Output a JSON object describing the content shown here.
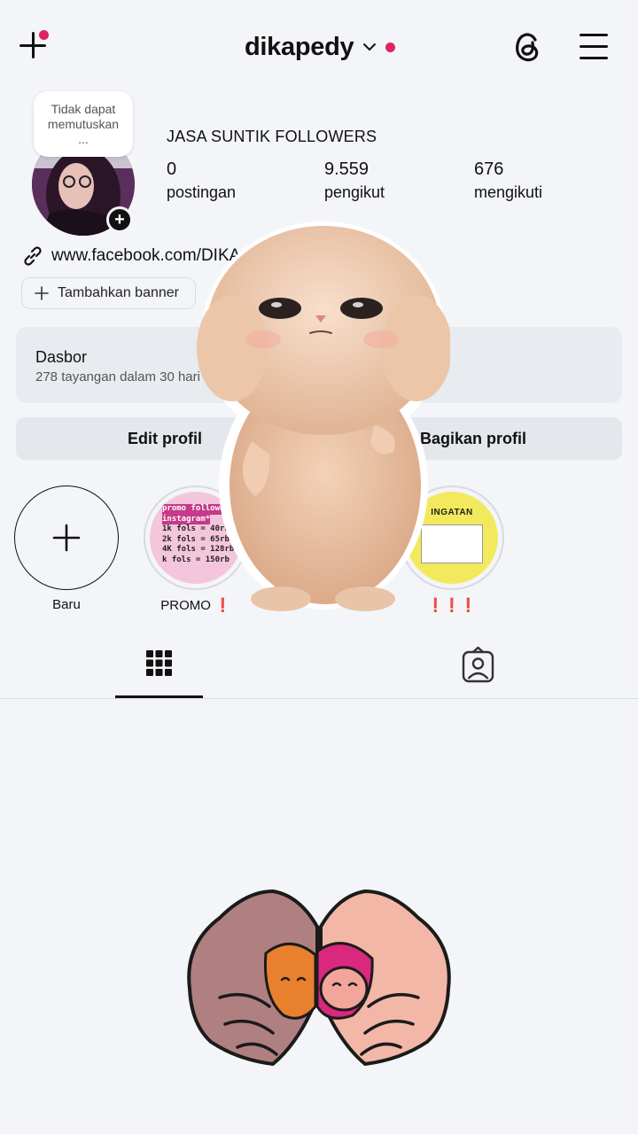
{
  "header": {
    "username": "dikapedy",
    "accent_color": "#e0245e"
  },
  "profile": {
    "note": [
      "Tidak dapat",
      "memutuskan",
      "..."
    ],
    "display_name": "JASA SUNTIK FOLLOWERS",
    "stats": [
      {
        "value": "0",
        "label": "postingan"
      },
      {
        "value": "9.559",
        "label": "pengikut"
      },
      {
        "value": "676",
        "label": "mengikuti"
      }
    ],
    "link": "www.facebook.com/DIKA",
    "add_banner": "Tambahkan banner"
  },
  "dashboard": {
    "title": "Dasbor",
    "subtitle": "278 tayangan dalam 30 hari t"
  },
  "actions": {
    "edit": "Edit profil",
    "share": "Bagikan profil"
  },
  "highlights": [
    {
      "label": "Baru",
      "icon": "plus-icon"
    },
    {
      "label": "PROMO ❗",
      "lines": [
        "promo followers",
        "instagram*",
        "1k fols = 40rb",
        "2k fols = 65rb",
        "4K fols = 128rb",
        "k fols = 150rb"
      ]
    },
    {
      "label": "~"
    },
    {
      "label": "❗❗❗",
      "title": "INGATAN"
    }
  ],
  "tabs": [
    {
      "name": "grid",
      "icon": "grid-icon"
    },
    {
      "name": "tagged",
      "icon": "tagged-person-icon"
    }
  ]
}
